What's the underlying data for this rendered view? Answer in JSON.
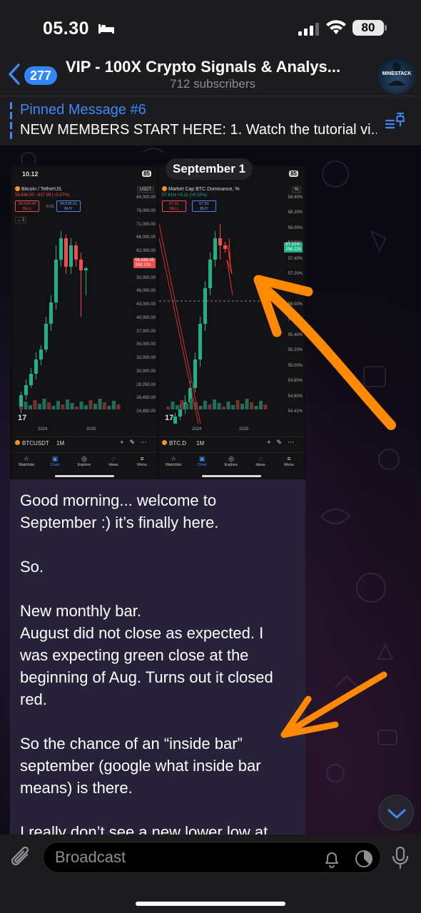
{
  "status_bar": {
    "time": "05.30",
    "battery": "80"
  },
  "header": {
    "back_count": "277",
    "title": "VIP - 100X Crypto Signals & Analys...",
    "subtitle": "712 subscribers",
    "avatar_text": "MINESTACK"
  },
  "pinned": {
    "title": "Pinned Message #6",
    "text": "NEW MEMBERS START HERE: 1. Watch the tutorial vi..."
  },
  "date_label": "September 1",
  "screenshot_left": {
    "time": "10.12",
    "battery": "85",
    "pair": "Bitcoin / TetherUS",
    "change": "58,636.00 −337.99 (−0.57%)",
    "currency": "USDT",
    "sell_price": "58,636.00",
    "sell_label": "SELL",
    "spread": "0.01",
    "buy_price": "58,636.01",
    "buy_label": "BUY",
    "indicator_count": "3",
    "price_tag": "58,636.00",
    "price_tag_time": "29d 22h",
    "y_labels": [
      "84,000.00",
      "76,000.00",
      "71,000.00",
      "66,000.00",
      "62,000.00",
      "54,000.00",
      "50,000.00",
      "46,000.00",
      "43,000.00",
      "40,000.00",
      "37,000.00",
      "34,000.00",
      "32,000.00",
      "30,000.00",
      "28,250.00",
      "26,450.00",
      "24,850.00"
    ],
    "x_labels": [
      "2024",
      "2025"
    ],
    "symbol": "BTCUSDT",
    "timeframe": "1M",
    "tabs": [
      "Watchlist",
      "Chart",
      "Explore",
      "Ideas",
      "Menu"
    ]
  },
  "screenshot_right": {
    "battery": "85",
    "pair": "Market Cap BTC Dominance, %",
    "change": "57.61% +0.11 (+0.19%)",
    "currency": "%",
    "sell_price": "57.51",
    "sell_label": "SELL",
    "buy_price": "57.51",
    "buy_label": "BUY",
    "price_tag": "57.51%",
    "price_tag_time": "29d 22h",
    "y_labels": [
      "58.40%",
      "58.20%",
      "58.00%",
      "57.80%",
      "57.40%",
      "57.20%",
      "57.00%",
      "56.00%",
      "55.60%",
      "55.40%",
      "55.20%",
      "55.00%",
      "54.80%",
      "54.60%",
      "54.41%"
    ],
    "x_labels": [
      "2024",
      "2025"
    ],
    "symbol": "BTC.D",
    "timeframe": "1M",
    "tabs": [
      "Watchlist",
      "Chart",
      "Explore",
      "Ideas",
      "Menu"
    ]
  },
  "message": {
    "text": "Good morning... welcome to September :) it’s finally here.\n\nSo.\n\nNew monthly bar.\nAugust did not close as expected. I was expecting green close at the beginning of Aug. Turns out it closed red.\n\nSo the chance of an “inside bar” september (google what inside bar means) is there.\n\nI really don’t see a new lower low at"
  },
  "input": {
    "placeholder": "Broadcast"
  },
  "colors": {
    "accent": "#3e88f7",
    "arrow": "#ff8a00",
    "bubble": "#27223a",
    "candle_up": "#1fb08a",
    "candle_down": "#f24b4b"
  }
}
